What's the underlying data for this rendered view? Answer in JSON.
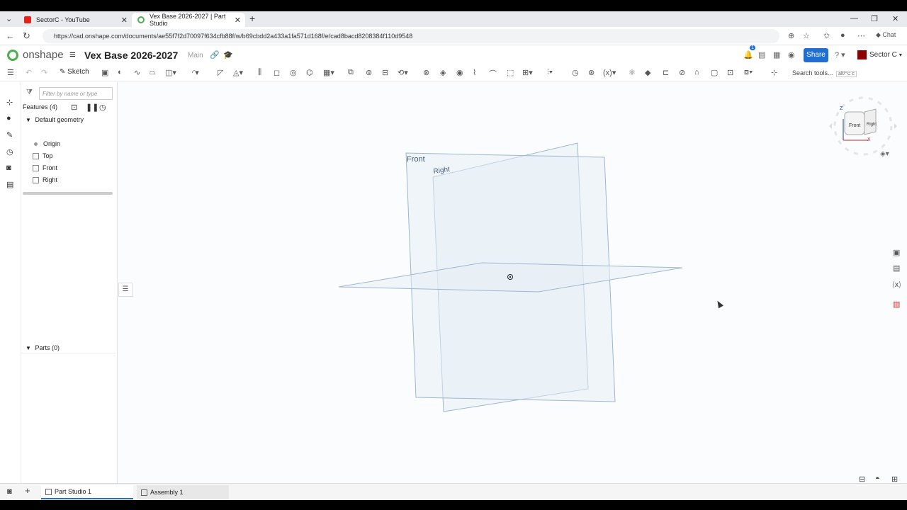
{
  "browser": {
    "tabs": [
      {
        "title": "SectorC - YouTube"
      },
      {
        "title": "Vex Base 2026-2027 | Part Studio"
      }
    ],
    "url": "https://cad.onshape.com/documents/ae55f7f2d70097f634cfb88f/w/b69cbdd2a433a1fa571d168f/e/cad8bacd8208384f110d9548",
    "chat_label": "Chat"
  },
  "app": {
    "brand": "onshape",
    "doc_title": "Vex Base 2026-2027",
    "branch": "Main",
    "share_label": "Share",
    "account_name": "Sector C",
    "notification_count": "1"
  },
  "toolbar": {
    "sketch_label": "Sketch",
    "search_label": "Search tools...",
    "search_shortcut": "alt/⌥ c"
  },
  "features": {
    "filter_placeholder": "Filter by name or type",
    "header": "Features (4)",
    "group": "Default geometry",
    "items": [
      "Origin",
      "Top",
      "Front",
      "Right"
    ],
    "parts_header": "Parts (0)"
  },
  "viewport": {
    "plane_front": "Front",
    "plane_right": "Right"
  },
  "viewcube": {
    "front": "Front",
    "right": "Right",
    "z_axis": "Z",
    "x_axis": "X"
  },
  "bottom_tabs": [
    "Part Studio 1",
    "Assembly 1"
  ],
  "colors": {
    "accent": "#1f6fd1",
    "brand_green": "#4caf50",
    "plane_stroke": "#9fb6cf",
    "plane_fill": "#e6eef6"
  }
}
